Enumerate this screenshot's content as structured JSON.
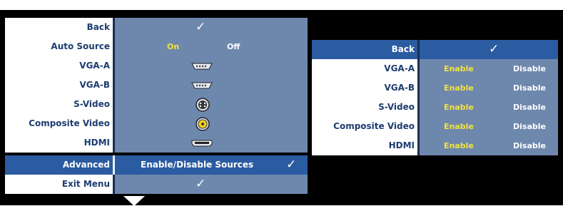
{
  "menu": {
    "check_glyph": "✓",
    "back_label": "Back",
    "auto_source": {
      "label": "Auto Source",
      "on": "On",
      "off": "Off"
    },
    "vga_a_label": "VGA-A",
    "vga_b_label": "VGA-B",
    "svideo_label": "S-Video",
    "composite_label": "Composite Video",
    "hdmi_label": "HDMI",
    "advanced": {
      "label": "Advanced",
      "value": "Enable/Disable Sources"
    },
    "exit_label": "Exit Menu",
    "icons": [
      "vga-icon",
      "vga-icon",
      "svideo-icon",
      "composite-icon",
      "hdmi-icon"
    ]
  },
  "submenu": {
    "back_label": "Back",
    "enable": "Enable",
    "disable": "Disable",
    "rows": [
      "VGA-A",
      "VGA-B",
      "S-Video",
      "Composite Video",
      "HDMI"
    ]
  },
  "colors": {
    "panel": "#6e88ad",
    "selected": "#2b5ba0",
    "label_text": "#1d3c70",
    "highlight_text": "#f4e33a"
  }
}
